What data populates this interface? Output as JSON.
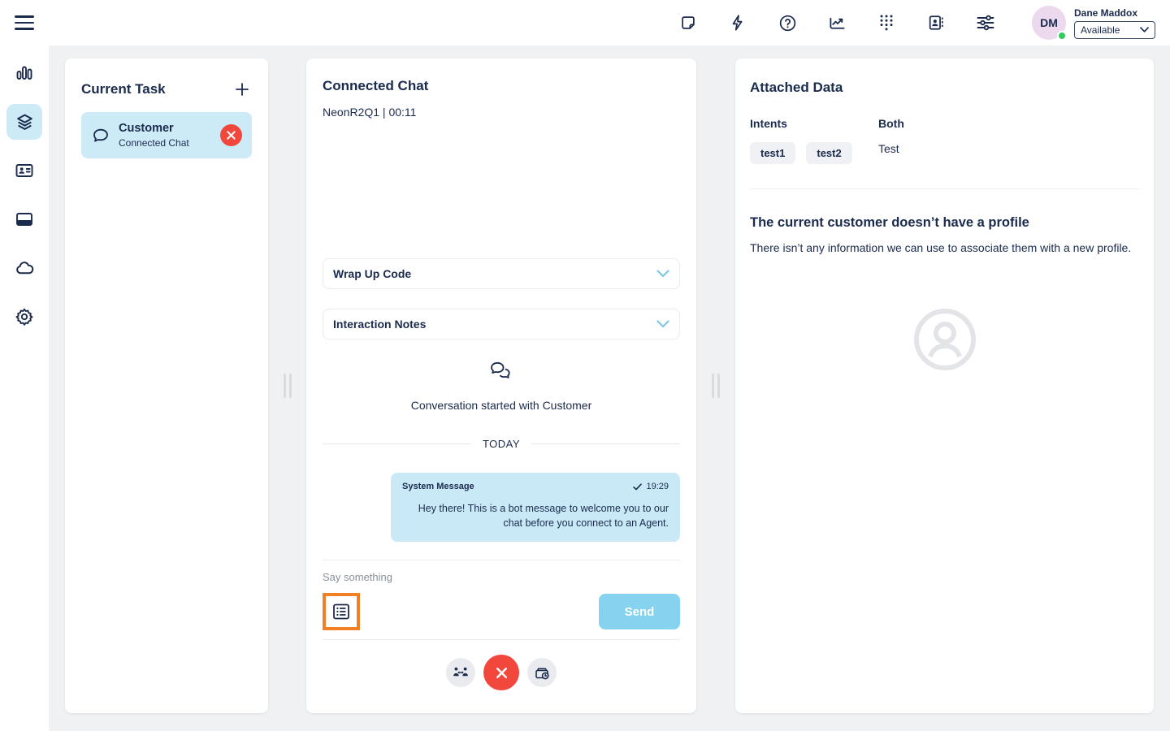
{
  "topbar": {
    "icons": [
      {
        "name": "notes-icon"
      },
      {
        "name": "quick-actions-icon"
      },
      {
        "name": "help-icon"
      },
      {
        "name": "performance-icon"
      },
      {
        "name": "dialpad-icon"
      },
      {
        "name": "directory-icon"
      },
      {
        "name": "settings-sliders-icon"
      }
    ],
    "user": {
      "initials": "DM",
      "name": "Dane Maddox",
      "status": "Available"
    }
  },
  "sidebar": {
    "items": [
      "bar-chart",
      "interactions-layers",
      "contact-card",
      "browser-window",
      "cloud",
      "gear"
    ],
    "active_item": "interactions-layers"
  },
  "current_task": {
    "title": "Current Task",
    "task": {
      "name": "Customer",
      "type": "Connected Chat"
    }
  },
  "chat": {
    "title": "Connected Chat",
    "subtitle": "NeonR2Q1 | 00:11",
    "wrap_up_label": "Wrap Up Code",
    "notes_label": "Interaction Notes",
    "started_text": "Conversation started with Customer",
    "day_divider": "TODAY",
    "message": {
      "sender": "System Message",
      "time": "19:29",
      "text": "Hey there! This is a bot message to welcome you to our chat before you connect to an Agent."
    },
    "input_placeholder": "Say something",
    "send_label": "Send"
  },
  "attached_data": {
    "title": "Attached Data",
    "intents_label": "Intents",
    "intents": [
      "test1",
      "test2"
    ],
    "both_label": "Both",
    "both_value": "Test",
    "no_profile_title": "The current customer doesn’t have a profile",
    "no_profile_text": "There isn’t any information we can use to associate them with a new profile."
  },
  "colors": {
    "navy": "#1b2b4d",
    "highlight_blue": "#cdeaf7",
    "bubble_blue": "#c9e9f7",
    "send_blue": "#85d3ef",
    "danger_red": "#f2473c",
    "annotation_orange": "#f08023",
    "status_green": "#2fcc5f",
    "workspace_bg": "#eff1f3"
  }
}
